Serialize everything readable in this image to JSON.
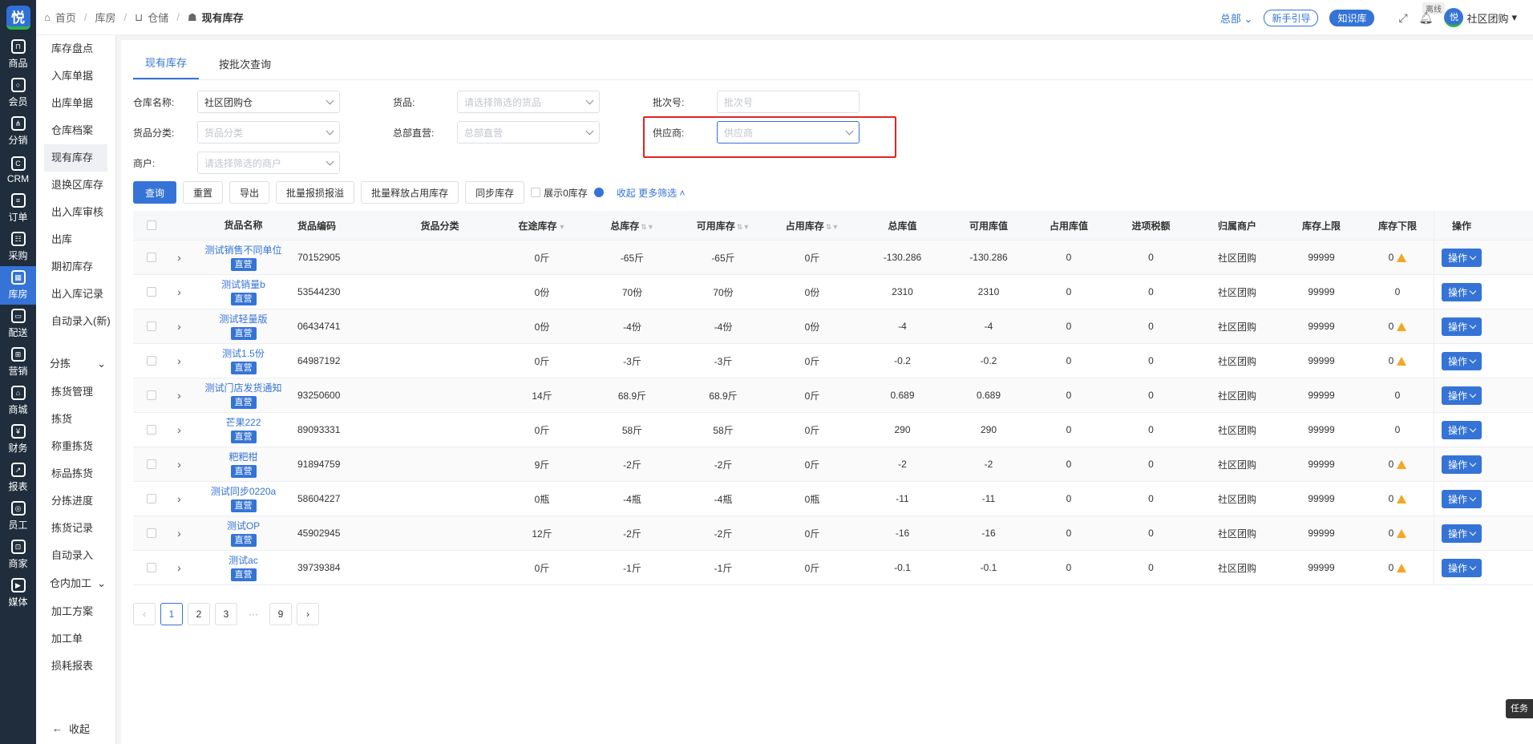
{
  "rail": {
    "items": [
      {
        "label": "商品",
        "icon": "bag-icon"
      },
      {
        "label": "会员",
        "icon": "user-icon"
      },
      {
        "label": "分销",
        "icon": "share-icon"
      },
      {
        "label": "CRM",
        "icon": "crm-icon"
      },
      {
        "label": "订单",
        "icon": "order-icon"
      },
      {
        "label": "采购",
        "icon": "purchase-icon"
      },
      {
        "label": "库房",
        "icon": "warehouse-icon"
      },
      {
        "label": "配送",
        "icon": "truck-icon"
      },
      {
        "label": "营销",
        "icon": "gift-icon"
      },
      {
        "label": "商城",
        "icon": "shop-icon"
      },
      {
        "label": "财务",
        "icon": "yen-icon"
      },
      {
        "label": "报表",
        "icon": "chart-icon"
      },
      {
        "label": "员工",
        "icon": "staff-icon"
      },
      {
        "label": "商家",
        "icon": "merchant-icon"
      },
      {
        "label": "媒体",
        "icon": "play-icon"
      }
    ],
    "logo": "悦"
  },
  "submenu": {
    "items": [
      "库存盘点",
      "入库单据",
      "出库单据",
      "仓库档案",
      "现有库存",
      "退换区库存",
      "出入库审核",
      "出库",
      "期初库存",
      "出入库记录",
      "自动录入(新)"
    ],
    "group1": "分拣",
    "group1_items": [
      "拣货管理",
      "拣货",
      "称重拣货",
      "标品拣货",
      "分拣进度",
      "拣货记录",
      "自动录入"
    ],
    "group2": "仓内加工",
    "group2_items": [
      "加工方案",
      "加工单",
      "损耗报表"
    ],
    "collapse": "收起"
  },
  "breadcrumb": {
    "home": "首页",
    "b1": "库房",
    "b2": "仓储",
    "current": "现有库存"
  },
  "topbar": {
    "hq": "总部",
    "guide": "新手引导",
    "knowledge": "知识库",
    "offline": "离线",
    "user": "社区团购"
  },
  "tabs": [
    "现有库存",
    "按批次查询"
  ],
  "filters": {
    "warehouse_label": "仓库名称:",
    "warehouse_value": "社区团购仓",
    "goods_label": "货品:",
    "goods_ph": "请选择筛选的货品",
    "batch_label": "批次号:",
    "batch_ph": "批次号",
    "category_label": "货品分类:",
    "category_ph": "货品分类",
    "hqdirect_label": "总部直营:",
    "hqdirect_ph": "总部直营",
    "supplier_label": "供应商:",
    "supplier_ph": "供应商",
    "merchant_label": "商户:",
    "merchant_ph": "请选择筛选的商户"
  },
  "actions": {
    "query": "查询",
    "reset": "重置",
    "export": "导出",
    "batch_loss": "批量报损报溢",
    "batch_release": "批量释放占用库存",
    "sync": "同步库存",
    "show_zero": "展示0库存",
    "collapse": "收起",
    "more": "更多筛选"
  },
  "table": {
    "headers": [
      "货品名称",
      "货品编码",
      "货品分类",
      "在途库存",
      "总库存",
      "可用库存",
      "占用库存",
      "总库值",
      "可用库值",
      "占用库值",
      "进项税额",
      "归属商户",
      "库存上限",
      "库存下限",
      "操作"
    ],
    "tag": "直营",
    "op": "操作",
    "rows": [
      {
        "name": "测试销售不同单位",
        "code": "70152905",
        "cat": "",
        "transit": "0斤",
        "total": "-65斤",
        "avail": "-65斤",
        "occ": "0斤",
        "tv": "-130.286",
        "av": "-130.286",
        "ov": "0",
        "tax": "0",
        "mer": "社区团购",
        "up": "99999",
        "low": "0",
        "warn": true
      },
      {
        "name": "测试销量b",
        "code": "53544230",
        "cat": "",
        "transit": "0份",
        "total": "70份",
        "avail": "70份",
        "occ": "0份",
        "tv": "2310",
        "av": "2310",
        "ov": "0",
        "tax": "0",
        "mer": "社区团购",
        "up": "99999",
        "low": "0",
        "warn": false
      },
      {
        "name": "测试轻量版",
        "code": "06434741",
        "cat": "",
        "transit": "0份",
        "total": "-4份",
        "avail": "-4份",
        "occ": "0份",
        "tv": "-4",
        "av": "-4",
        "ov": "0",
        "tax": "0",
        "mer": "社区团购",
        "up": "99999",
        "low": "0",
        "warn": true
      },
      {
        "name": "测试1.5份",
        "code": "64987192",
        "cat": "",
        "transit": "0斤",
        "total": "-3斤",
        "avail": "-3斤",
        "occ": "0斤",
        "tv": "-0.2",
        "av": "-0.2",
        "ov": "0",
        "tax": "0",
        "mer": "社区团购",
        "up": "99999",
        "low": "0",
        "warn": true
      },
      {
        "name": "测试门店发货通知",
        "code": "93250600",
        "cat": "",
        "transit": "14斤",
        "total": "68.9斤",
        "avail": "68.9斤",
        "occ": "0斤",
        "tv": "0.689",
        "av": "0.689",
        "ov": "0",
        "tax": "0",
        "mer": "社区团购",
        "up": "99999",
        "low": "0",
        "warn": false
      },
      {
        "name": "芒果222",
        "code": "89093331",
        "cat": "",
        "transit": "0斤",
        "total": "58斤",
        "avail": "58斤",
        "occ": "0斤",
        "tv": "290",
        "av": "290",
        "ov": "0",
        "tax": "0",
        "mer": "社区团购",
        "up": "99999",
        "low": "0",
        "warn": false
      },
      {
        "name": "粑粑柑",
        "code": "91894759",
        "cat": "",
        "transit": "9斤",
        "total": "-2斤",
        "avail": "-2斤",
        "occ": "0斤",
        "tv": "-2",
        "av": "-2",
        "ov": "0",
        "tax": "0",
        "mer": "社区团购",
        "up": "99999",
        "low": "0",
        "warn": true
      },
      {
        "name": "测试同步0220a",
        "code": "58604227",
        "cat": "",
        "transit": "0瓶",
        "total": "-4瓶",
        "avail": "-4瓶",
        "occ": "0瓶",
        "tv": "-11",
        "av": "-11",
        "ov": "0",
        "tax": "0",
        "mer": "社区团购",
        "up": "99999",
        "low": "0",
        "warn": true
      },
      {
        "name": "测试OP",
        "code": "45902945",
        "cat": "",
        "transit": "12斤",
        "total": "-2斤",
        "avail": "-2斤",
        "occ": "0斤",
        "tv": "-16",
        "av": "-16",
        "ov": "0",
        "tax": "0",
        "mer": "社区团购",
        "up": "99999",
        "low": "0",
        "warn": true
      },
      {
        "name": "测试ac",
        "code": "39739384",
        "cat": "",
        "transit": "0斤",
        "total": "-1斤",
        "avail": "-1斤",
        "occ": "0斤",
        "tv": "-0.1",
        "av": "-0.1",
        "ov": "0",
        "tax": "0",
        "mer": "社区团购",
        "up": "99999",
        "low": "0",
        "warn": true
      }
    ]
  },
  "pager": {
    "pages": [
      "1",
      "2",
      "3",
      "···",
      "9"
    ]
  },
  "task": "任务"
}
